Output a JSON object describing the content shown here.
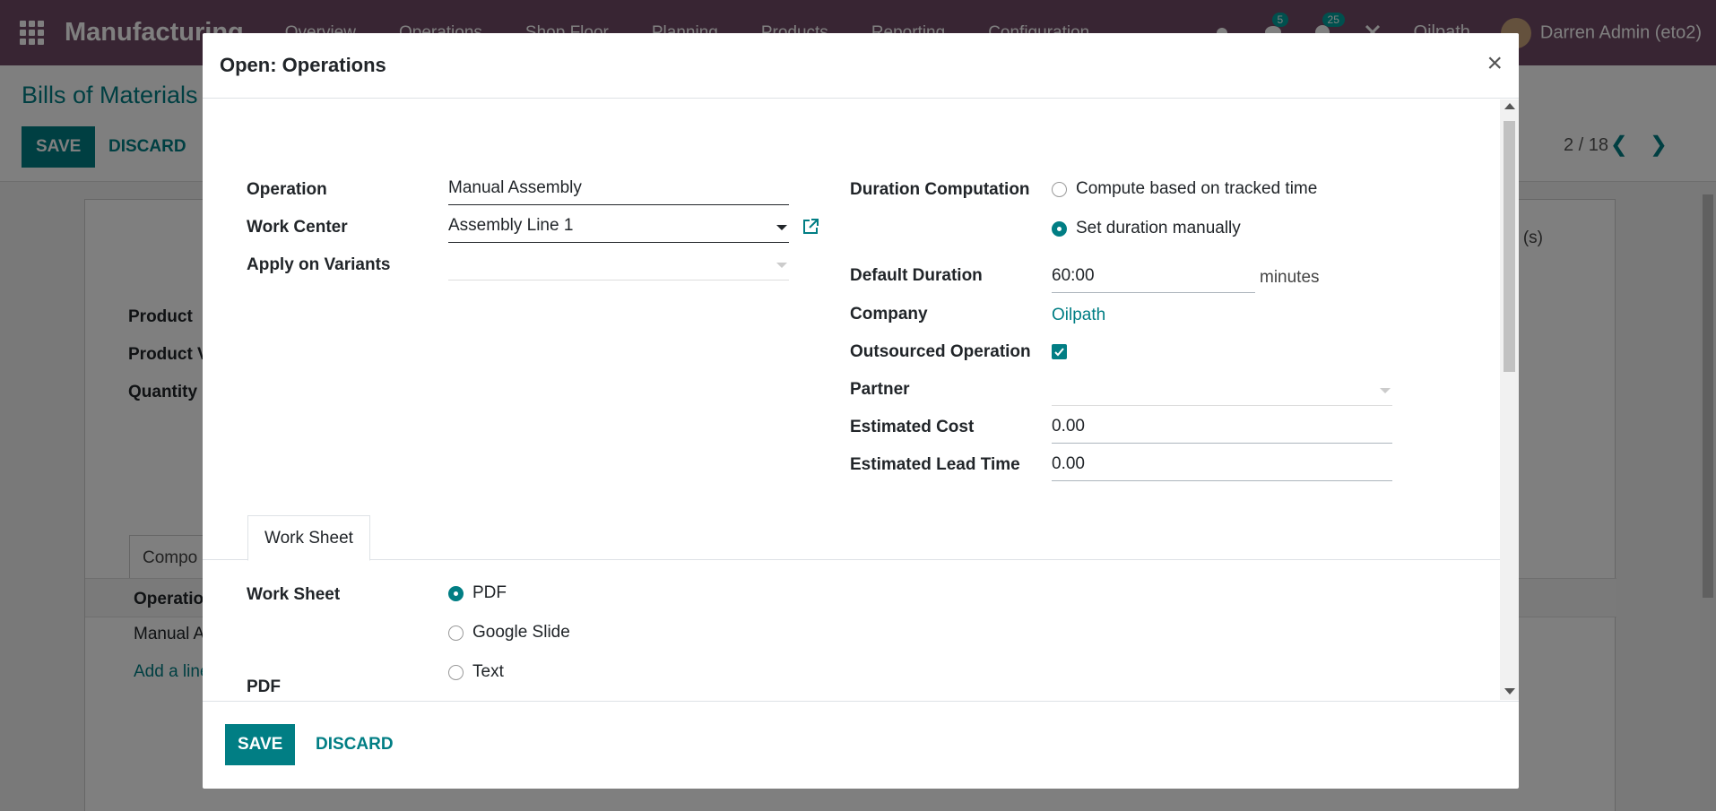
{
  "app": {
    "brand": "Manufacturing",
    "menu": [
      "Overview",
      "Operations",
      "Shop Floor",
      "Planning",
      "Products",
      "Reporting",
      "Configuration"
    ],
    "messages_count": "5",
    "activities_count": "25",
    "company": "Oilpath",
    "user": "Darren Admin (eto2)"
  },
  "background": {
    "breadcrumb": "Bills of Materials",
    "save_label": "SAVE",
    "discard_label": "DISCARD",
    "pager": "2 / 18",
    "labels": [
      "Product",
      "Product V",
      "Quantity"
    ],
    "tab_label": "Compo",
    "tab_right": "(s)",
    "table_header": "Operation",
    "row_text": "Manual A",
    "add_line": "Add a line"
  },
  "modal": {
    "title": "Open: Operations",
    "close_label": "×",
    "left": {
      "operation_label": "Operation",
      "operation_value": "Manual Assembly",
      "work_center_label": "Work Center",
      "work_center_value": "Assembly Line 1",
      "variants_label": "Apply on Variants",
      "variants_value": ""
    },
    "right": {
      "duration_label": "Duration Computation",
      "duration_options": [
        {
          "label": "Compute based on tracked time",
          "selected": false
        },
        {
          "label": "Set duration manually",
          "selected": true
        }
      ],
      "default_duration_label": "Default Duration",
      "default_duration_value": "60:00",
      "default_duration_unit": "minutes",
      "company_label": "Company",
      "company_value": "Oilpath",
      "outsourced_label": "Outsourced Operation",
      "outsourced_checked": true,
      "partner_label": "Partner",
      "partner_value": "",
      "cost_label": "Estimated Cost",
      "cost_value": "0.00",
      "lead_label": "Estimated Lead Time",
      "lead_value": "0.00"
    },
    "tabs": [
      "Work Sheet"
    ],
    "worksheet": {
      "label": "Work Sheet",
      "options": [
        {
          "label": "PDF",
          "selected": true
        },
        {
          "label": "Google Slide",
          "selected": false
        },
        {
          "label": "Text",
          "selected": false
        }
      ],
      "pdf_label": "PDF"
    },
    "footer": {
      "save_label": "SAVE",
      "discard_label": "DISCARD"
    }
  },
  "colors": {
    "navbar": "#714b67",
    "accent": "#017e84"
  }
}
